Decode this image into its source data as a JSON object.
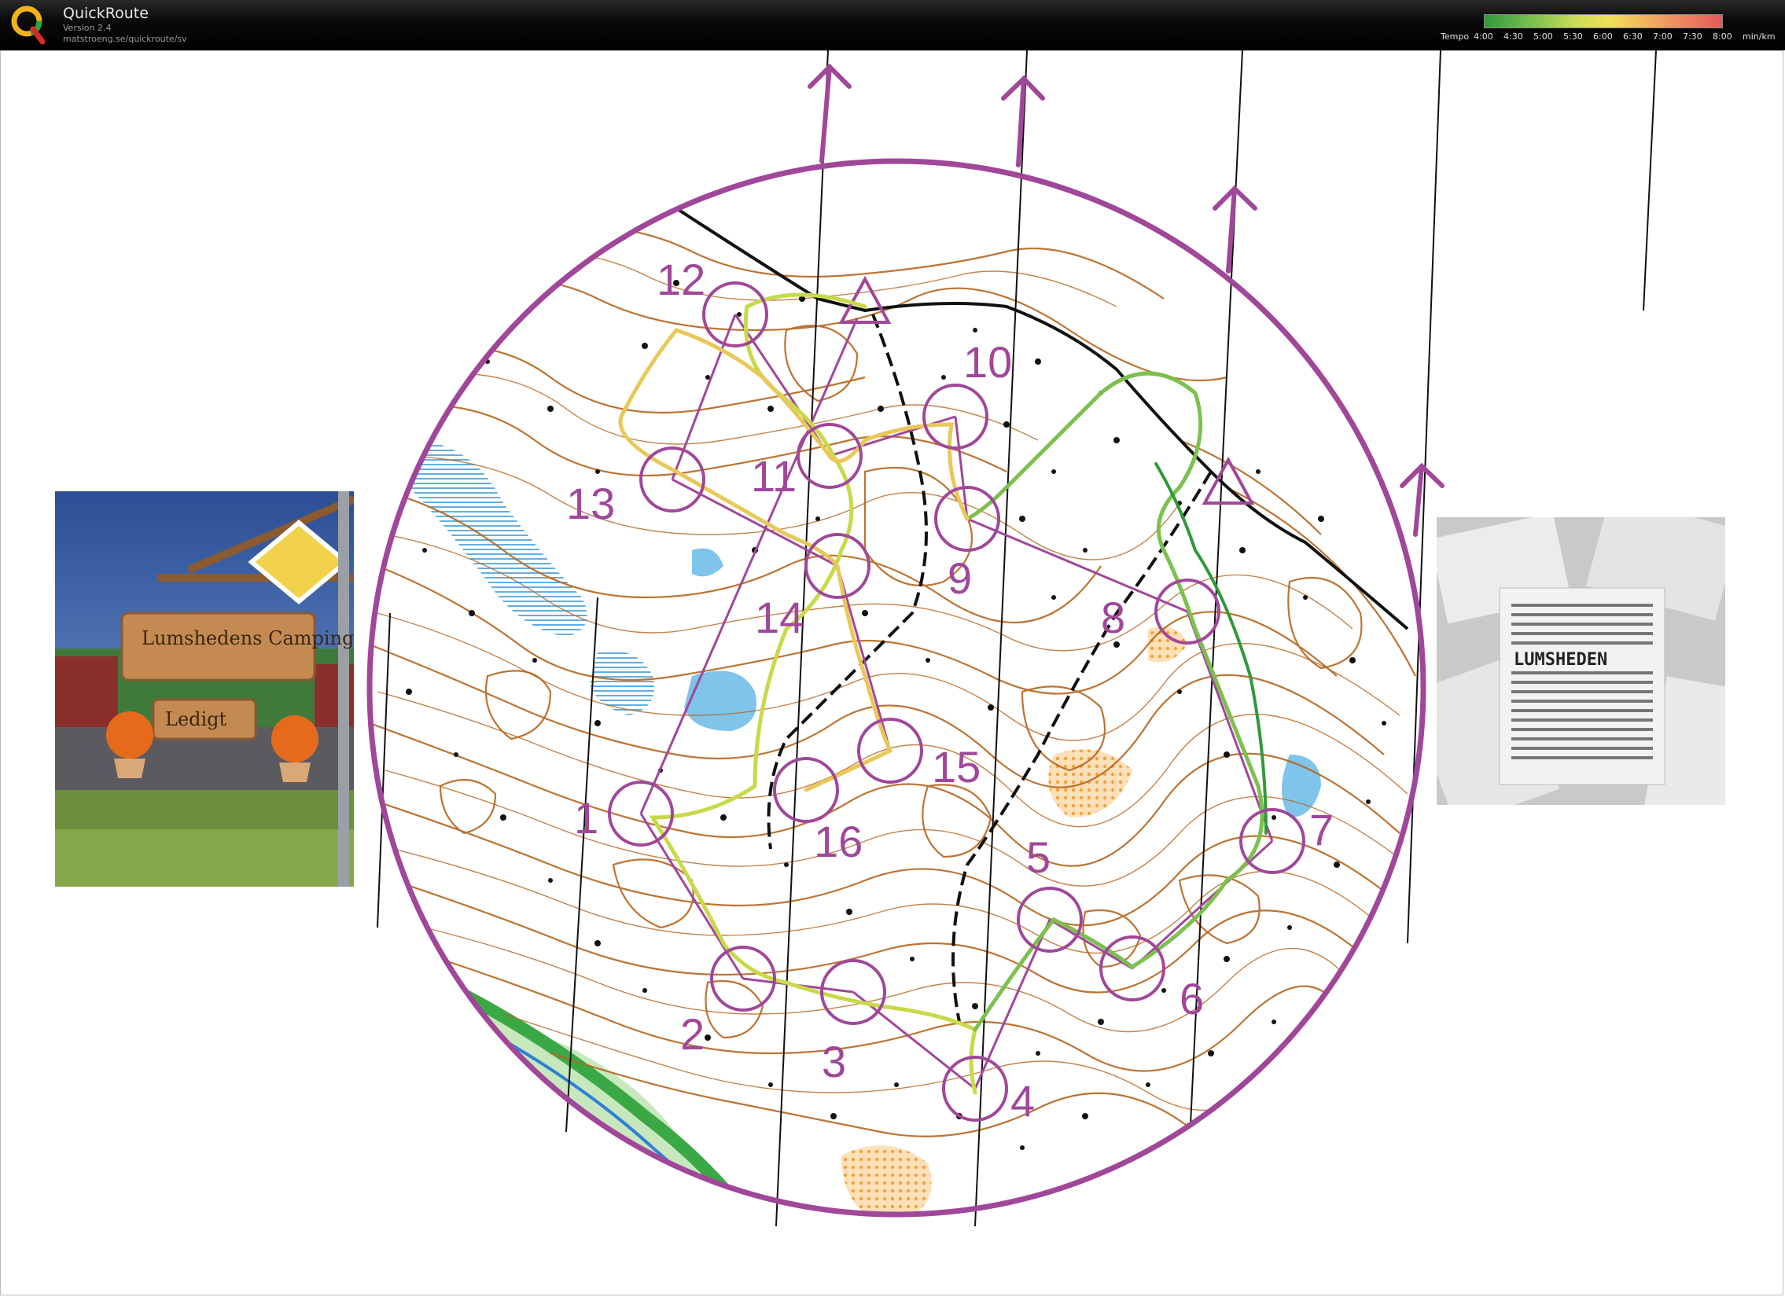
{
  "app": {
    "title": "QuickRoute",
    "version": "Version 2.4",
    "url": "matstroeng.se/quickroute/sv"
  },
  "legend": {
    "title": "Tempo",
    "ticks": [
      "4:00",
      "4:30",
      "5:00",
      "5:30",
      "6:00",
      "6:30",
      "7:00",
      "7:30",
      "8:00"
    ],
    "unit": "min/km",
    "colors": [
      "#2f9a3a",
      "#7cc04e",
      "#c9dc56",
      "#f0e05a",
      "#f3b85c",
      "#ee8a62",
      "#e35a5a"
    ]
  },
  "map": {
    "course_color": "#a0479a",
    "contour_color": "#b5651d",
    "route_color": "#c8d94a",
    "controls": [
      "1",
      "2",
      "3",
      "4",
      "5",
      "6",
      "7",
      "8",
      "9",
      "10",
      "11",
      "12",
      "13",
      "14",
      "15",
      "16"
    ]
  },
  "photos": {
    "left_sign_text": "Lumshedens Camping",
    "left_sub_sign_text": "Ledigt",
    "right_text": "LUMSHEDEN"
  },
  "icons": {
    "logo": "quickroute-q-logo",
    "north_arrow": "north-arrow-icon"
  }
}
